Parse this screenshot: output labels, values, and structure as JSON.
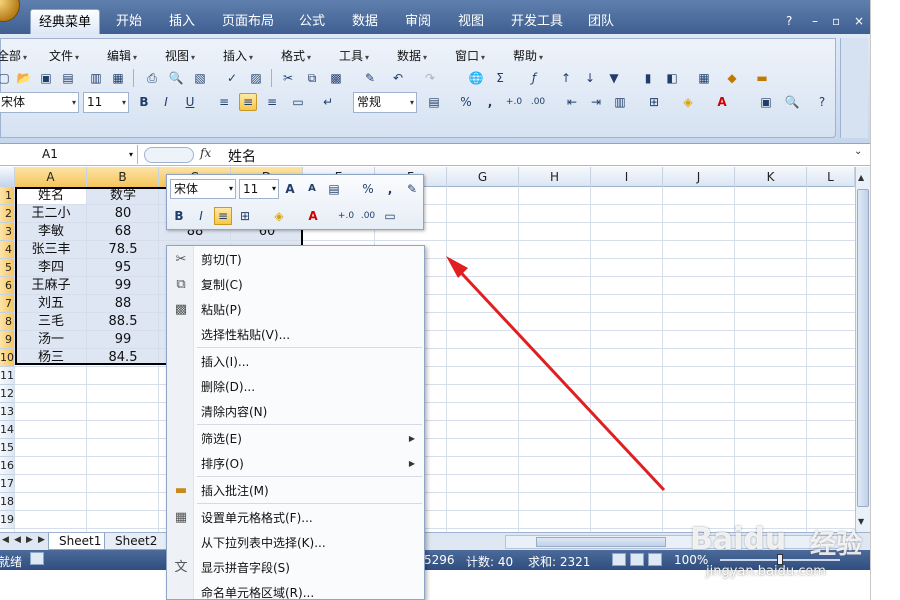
{
  "ribbon": {
    "tabs": [
      "经典菜单",
      "开始",
      "插入",
      "页面布局",
      "公式",
      "数据",
      "审阅",
      "视图",
      "开发工具",
      "团队"
    ],
    "active_tab": "经典菜单",
    "menus": [
      "全部",
      "文件",
      "编辑",
      "视图",
      "插入",
      "格式",
      "工具",
      "数据",
      "窗口",
      "帮助"
    ],
    "font": "宋体",
    "font_size": "11",
    "number_format": "常规",
    "percent": "%",
    "comma": ","
  },
  "formula_bar": {
    "name_box": "A1",
    "fx": "fx",
    "content": "姓名"
  },
  "columns": [
    "A",
    "B",
    "C",
    "D",
    "E",
    "F",
    "G",
    "H",
    "I",
    "J",
    "K",
    "L"
  ],
  "rows": [
    "1",
    "2",
    "3",
    "4",
    "5",
    "6",
    "7",
    "8",
    "9",
    "10",
    "11",
    "12",
    "13",
    "14",
    "15",
    "16",
    "17",
    "18",
    "19"
  ],
  "table": {
    "header": [
      "姓名",
      "数学"
    ],
    "names": [
      "王二小",
      "李敏",
      "张三丰",
      "李四",
      "王麻子",
      "刘五",
      "三毛",
      "汤一",
      "杨三"
    ],
    "math": [
      "80",
      "68",
      "78.5",
      "95",
      "99",
      "88",
      "88.5",
      "99",
      "84.5"
    ],
    "partial_c3": "88",
    "partial_d3": "60"
  },
  "sheet_tabs": [
    "Sheet1",
    "Sheet2"
  ],
  "status": {
    "ready": "就绪",
    "average": "5296",
    "count": "计数: 40",
    "sum": "求和: 2321",
    "zoom": "100%"
  },
  "minibar": {
    "font": "宋体",
    "font_size": "11",
    "percent": "%",
    "comma": ","
  },
  "context_menu": [
    {
      "label": "剪切(T)",
      "icon": "scissors-icon"
    },
    {
      "label": "复制(C)",
      "icon": "copy-icon"
    },
    {
      "label": "粘贴(P)",
      "icon": "paste-icon"
    },
    {
      "label": "选择性粘贴(V)...",
      "icon": ""
    },
    {
      "label": "插入(I)...",
      "icon": ""
    },
    {
      "label": "删除(D)...",
      "icon": ""
    },
    {
      "label": "清除内容(N)",
      "icon": ""
    },
    {
      "label": "筛选(E)",
      "icon": "",
      "submenu": true
    },
    {
      "label": "排序(O)",
      "icon": "",
      "submenu": true
    },
    {
      "label": "插入批注(M)",
      "icon": "folder-comment-icon"
    },
    {
      "label": "设置单元格格式(F)...",
      "icon": "format-cells-icon"
    },
    {
      "label": "从下拉列表中选择(K)...",
      "icon": ""
    },
    {
      "label": "显示拼音字段(S)",
      "icon": "phonetic-icon"
    },
    {
      "label": "命名单元格区域(R)...",
      "icon": ""
    }
  ],
  "watermark": {
    "brand": "Baidu",
    "cn": "经验",
    "url": "jingyan.baidu.com"
  },
  "colors": {
    "accent": "#3e5f90",
    "arrow": "#e02020",
    "selection": "#dfe6f3"
  }
}
